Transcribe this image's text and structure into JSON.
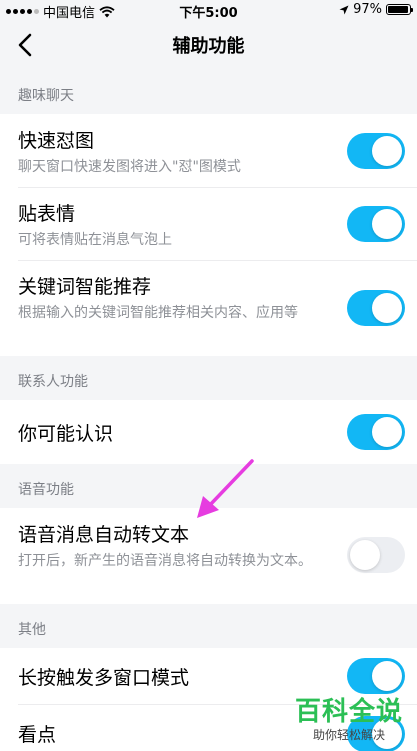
{
  "status_bar": {
    "carrier": "中国电信",
    "time": "下午5:00",
    "battery": "97%",
    "battery_level": 0.97
  },
  "nav": {
    "title": "辅助功能",
    "back_icon": "chevron-left-icon"
  },
  "sections": [
    {
      "header": "趣味聊天",
      "items": [
        {
          "label": "快速怼图",
          "desc": "聊天窗口快速发图将进入\"怼\"图模式",
          "enabled": true
        },
        {
          "label": "贴表情",
          "desc": "可将表情贴在消息气泡上",
          "enabled": true
        },
        {
          "label": "关键词智能推荐",
          "desc": "根据输入的关键词智能推荐相关内容、应用等",
          "enabled": true
        }
      ]
    },
    {
      "header": "联系人功能",
      "items": [
        {
          "label": "你可能认识",
          "enabled": true
        }
      ]
    },
    {
      "header": "语音功能",
      "items": [
        {
          "label": "语音消息自动转文本",
          "desc": "打开后，新产生的语音消息将自动转换为文本。",
          "enabled": false
        }
      ]
    },
    {
      "header": "其他",
      "items": [
        {
          "label": "长按触发多窗口模式",
          "enabled": true
        },
        {
          "label": "看点",
          "enabled": true
        }
      ]
    }
  ],
  "watermark": {
    "brand": "百科全说",
    "sub": "助你轻松解决"
  },
  "colors": {
    "toggle_on": "#12b7f5",
    "toggle_off": "#eceef2",
    "annotation_arrow": "#e63ce0",
    "watermark": "#2bbf55"
  }
}
